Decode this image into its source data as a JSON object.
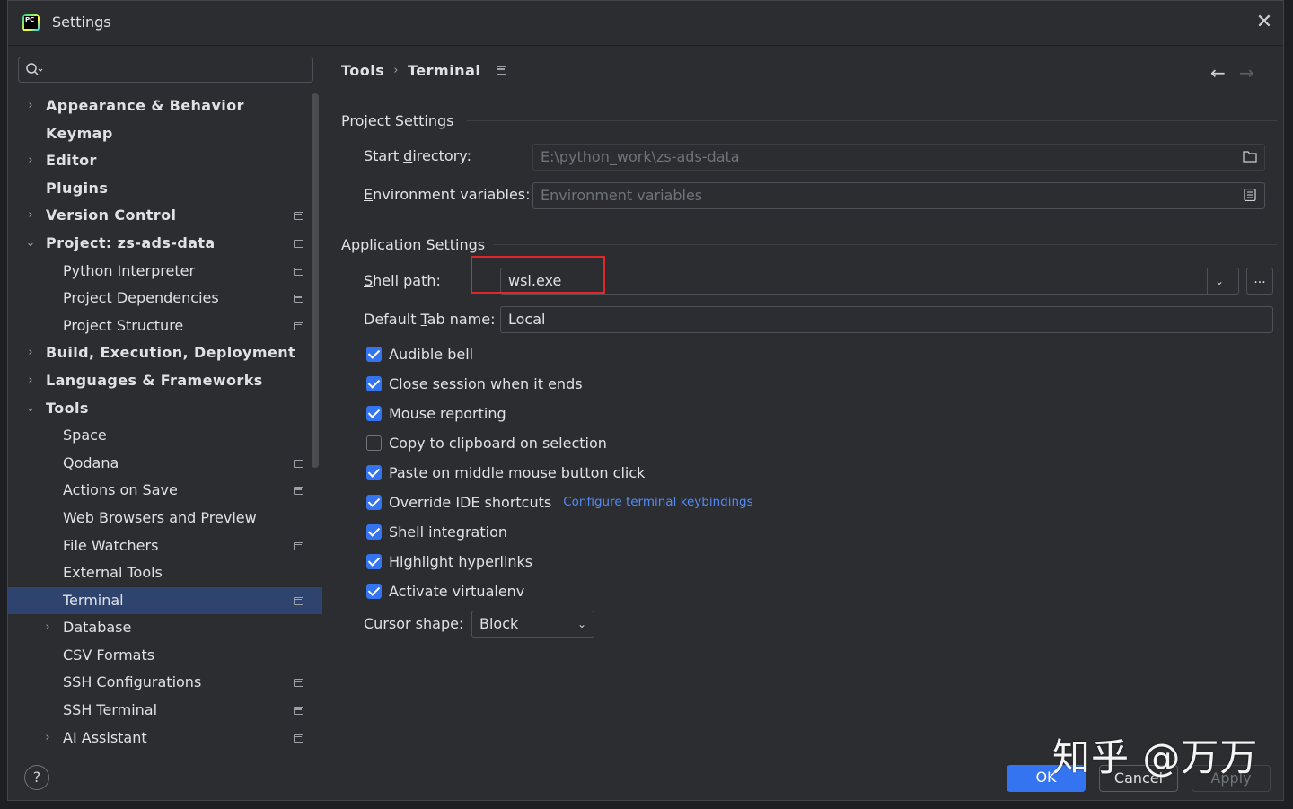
{
  "window": {
    "title": "Settings",
    "close_glyph": "✕"
  },
  "sidebar": {
    "search": {
      "value": ""
    },
    "items": [
      {
        "label": "Appearance & Behavior",
        "level": 0,
        "arrow": "›",
        "badge": false
      },
      {
        "label": "Keymap",
        "level": 0,
        "arrow": "",
        "badge": false
      },
      {
        "label": "Editor",
        "level": 0,
        "arrow": "›",
        "badge": false
      },
      {
        "label": "Plugins",
        "level": 0,
        "arrow": "",
        "badge": false
      },
      {
        "label": "Version Control",
        "level": 0,
        "arrow": "›",
        "badge": true
      },
      {
        "label": "Project: zs-ads-data",
        "level": 0,
        "arrow": "⌄",
        "badge": true
      },
      {
        "label": "Python Interpreter",
        "level": 1,
        "arrow": "",
        "badge": true
      },
      {
        "label": "Project Dependencies",
        "level": 1,
        "arrow": "",
        "badge": true
      },
      {
        "label": "Project Structure",
        "level": 1,
        "arrow": "",
        "badge": true
      },
      {
        "label": "Build, Execution, Deployment",
        "level": 0,
        "arrow": "›",
        "badge": false
      },
      {
        "label": "Languages & Frameworks",
        "level": 0,
        "arrow": "›",
        "badge": false
      },
      {
        "label": "Tools",
        "level": 0,
        "arrow": "⌄",
        "badge": false
      },
      {
        "label": "Space",
        "level": 1,
        "arrow": "",
        "badge": false
      },
      {
        "label": "Qodana",
        "level": 1,
        "arrow": "",
        "badge": true
      },
      {
        "label": "Actions on Save",
        "level": 1,
        "arrow": "",
        "badge": true
      },
      {
        "label": "Web Browsers and Preview",
        "level": 1,
        "arrow": "",
        "badge": false
      },
      {
        "label": "File Watchers",
        "level": 1,
        "arrow": "",
        "badge": true
      },
      {
        "label": "External Tools",
        "level": 1,
        "arrow": "",
        "badge": false
      },
      {
        "label": "Terminal",
        "level": 1,
        "arrow": "",
        "badge": true,
        "selected": true
      },
      {
        "label": "Database",
        "level": 1,
        "arrow": "›",
        "badge": false
      },
      {
        "label": "CSV Formats",
        "level": 1,
        "arrow": "",
        "badge": false
      },
      {
        "label": "SSH Configurations",
        "level": 1,
        "arrow": "",
        "badge": true
      },
      {
        "label": "SSH Terminal",
        "level": 1,
        "arrow": "",
        "badge": true
      },
      {
        "label": "AI Assistant",
        "level": 1,
        "arrow": "›",
        "badge": true
      }
    ]
  },
  "breadcrumb": {
    "parent": "Tools",
    "separator": "›",
    "current": "Terminal"
  },
  "nav": {
    "back": "←",
    "forward": "→"
  },
  "project_settings": {
    "title": "Project Settings",
    "start_directory": {
      "label_pre": "Start ",
      "label_u": "d",
      "label_post": "irectory:",
      "value": "E:\\python_work\\zs-ads-data"
    },
    "env_vars": {
      "label_pre": "",
      "label_u": "E",
      "label_post": "nvironment variables:",
      "placeholder": "Environment variables"
    }
  },
  "application_settings": {
    "title": "Application Settings",
    "shell_path": {
      "label_pre": "",
      "label_u": "S",
      "label_post": "hell path:",
      "value": "wsl.exe",
      "browse": "..."
    },
    "default_tab": {
      "label_pre": "Default ",
      "label_u": "T",
      "label_post": "ab name:",
      "value": "Local"
    },
    "checkboxes": [
      {
        "label": "Audible bell",
        "checked": true
      },
      {
        "label": "Close session when it ends",
        "checked": true
      },
      {
        "label": "Mouse reporting",
        "checked": true
      },
      {
        "label": "Copy to clipboard on selection",
        "checked": false
      },
      {
        "label": "Paste on middle mouse button click",
        "checked": true
      },
      {
        "label": "Override IDE shortcuts",
        "checked": true,
        "link": "Configure terminal keybindings"
      },
      {
        "label": "Shell integration",
        "checked": true
      },
      {
        "label": "Highlight hyperlinks",
        "checked": true
      },
      {
        "label": "Activate virtualenv",
        "checked": true
      }
    ],
    "cursor_shape": {
      "label": "Cursor shape:",
      "value": "Block"
    }
  },
  "footer": {
    "help": "?",
    "ok": "OK",
    "cancel": "Cancel",
    "apply": "Apply"
  },
  "watermark": "知乎 @万万",
  "colors": {
    "accent": "#3574f0",
    "selection": "#2e436e",
    "link": "#548af7",
    "highlight_box": "#e0282a",
    "background": "#2b2d30"
  }
}
